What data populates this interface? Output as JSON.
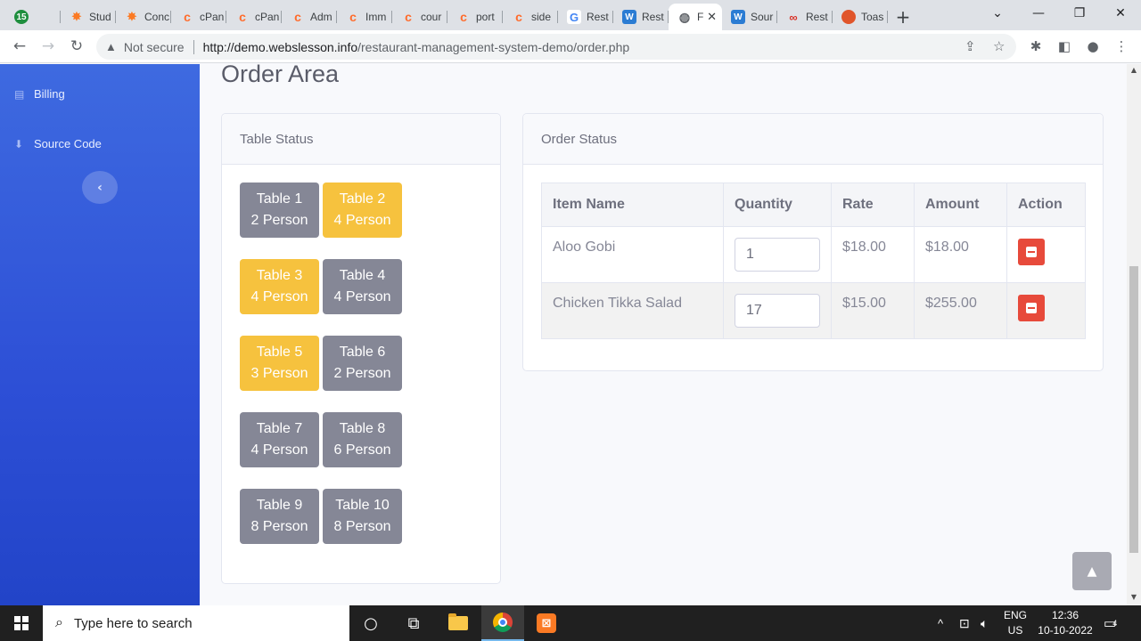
{
  "browser": {
    "tabs": [
      {
        "label": "15",
        "icon": "badge-icon"
      },
      {
        "label": "Stud",
        "icon": "xampp-icon"
      },
      {
        "label": "Conc",
        "icon": "xampp-icon"
      },
      {
        "label": "cPan",
        "icon": "cpanel-icon"
      },
      {
        "label": "cPan",
        "icon": "cpanel-icon"
      },
      {
        "label": "Adm",
        "icon": "cpanel-icon"
      },
      {
        "label": "Imm",
        "icon": "cpanel-icon"
      },
      {
        "label": "cour",
        "icon": "cpanel-icon"
      },
      {
        "label": "port",
        "icon": "cpanel-icon"
      },
      {
        "label": "side",
        "icon": "cpanel-icon"
      },
      {
        "label": "Rest",
        "icon": "google-icon"
      },
      {
        "label": "Rest",
        "icon": "word-icon"
      },
      {
        "label": "F",
        "icon": "globe-icon",
        "active": true
      },
      {
        "label": "Sour",
        "icon": "word-icon"
      },
      {
        "label": "Rest",
        "icon": "ring-icon"
      },
      {
        "label": "Toas",
        "icon": "toast-icon"
      }
    ],
    "new_tab": "+",
    "security_label": "Not secure",
    "url_host": "http://demo.webslesson.info",
    "url_path": "/restaurant-management-system-demo/order.php"
  },
  "sidebar": {
    "items": [
      {
        "label": "Billing",
        "icon": "file-icon"
      },
      {
        "label": "Source Code",
        "icon": "download-icon"
      }
    ],
    "collapse_glyph": "‹"
  },
  "page": {
    "title": "Order Area"
  },
  "table_status": {
    "header": "Table Status",
    "tables": [
      {
        "name": "Table 1",
        "capacity": "2 Person",
        "status": "free",
        "color": "#858796"
      },
      {
        "name": "Table 2",
        "capacity": "4 Person",
        "status": "booked",
        "color": "#f6c23e"
      },
      {
        "name": "Table 3",
        "capacity": "4 Person",
        "status": "booked",
        "color": "#f6c23e"
      },
      {
        "name": "Table 4",
        "capacity": "4 Person",
        "status": "free",
        "color": "#858796"
      },
      {
        "name": "Table 5",
        "capacity": "3 Person",
        "status": "booked",
        "color": "#f6c23e"
      },
      {
        "name": "Table 6",
        "capacity": "2 Person",
        "status": "free",
        "color": "#858796"
      },
      {
        "name": "Table 7",
        "capacity": "4 Person",
        "status": "free",
        "color": "#858796"
      },
      {
        "name": "Table 8",
        "capacity": "6 Person",
        "status": "free",
        "color": "#858796"
      },
      {
        "name": "Table 9",
        "capacity": "8 Person",
        "status": "free",
        "color": "#858796"
      },
      {
        "name": "Table 10",
        "capacity": "8 Person",
        "status": "free",
        "color": "#858796"
      }
    ]
  },
  "order_status": {
    "header": "Order Status",
    "columns": [
      "Item Name",
      "Quantity",
      "Rate",
      "Amount",
      "Action"
    ],
    "rows": [
      {
        "item": "Aloo Gobi",
        "quantity": "1",
        "rate": "$18.00",
        "amount": "$18.00"
      },
      {
        "item": "Chicken Tikka Salad",
        "quantity": "17",
        "rate": "$15.00",
        "amount": "$255.00"
      }
    ]
  },
  "taskbar": {
    "search_placeholder": "Type here to search",
    "lang_top": "ENG",
    "lang_bottom": "US",
    "time": "12:36",
    "date": "10-10-2022",
    "notifications": "4"
  },
  "colors": {
    "sidebar": "#3e6ae0",
    "table_free": "#858796",
    "table_booked": "#f6c23e",
    "danger": "#e74a3b"
  }
}
